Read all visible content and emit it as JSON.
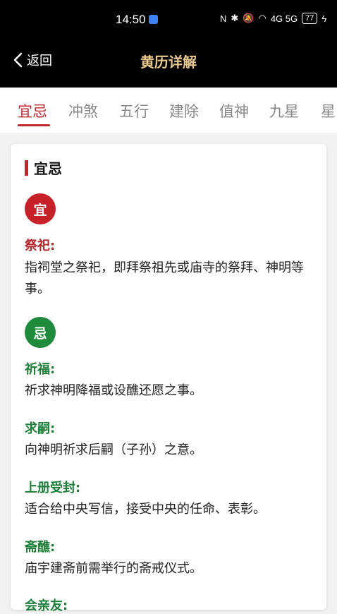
{
  "status_bar": {
    "time": "14:50",
    "network": "4G 5G",
    "battery": "77"
  },
  "header": {
    "back_label": "返回",
    "title": "黄历详解"
  },
  "tabs": [
    {
      "label": "宜忌",
      "active": true
    },
    {
      "label": "冲煞",
      "active": false
    },
    {
      "label": "五行",
      "active": false
    },
    {
      "label": "建除",
      "active": false
    },
    {
      "label": "值神",
      "active": false
    },
    {
      "label": "九星",
      "active": false
    },
    {
      "label": "星",
      "active": false
    }
  ],
  "card": {
    "title": "宜忌",
    "yi": {
      "badge": "宜",
      "items": [
        {
          "term": "祭祀:",
          "desc": "指祠堂之祭祀，即拜祭祖先或庙寺的祭拜、神明等事。"
        }
      ]
    },
    "ji": {
      "badge": "忌",
      "items": [
        {
          "term": "祈福:",
          "desc": "祈求神明降福或设醮还愿之事。"
        },
        {
          "term": "求嗣:",
          "desc": "向神明祈求后嗣（子孙）之意。"
        },
        {
          "term": "上册受封:",
          "desc": "适合给中央写信，接受中央的任命、表彰。"
        },
        {
          "term": "斋醮:",
          "desc": "庙宇建斋前需举行的斋戒仪式。"
        },
        {
          "term": "会亲友:",
          "desc": ""
        }
      ]
    }
  },
  "colors": {
    "accent_red": "#c0272d",
    "accent_green": "#1e8a3c",
    "title_gold": "#e9c98f"
  }
}
